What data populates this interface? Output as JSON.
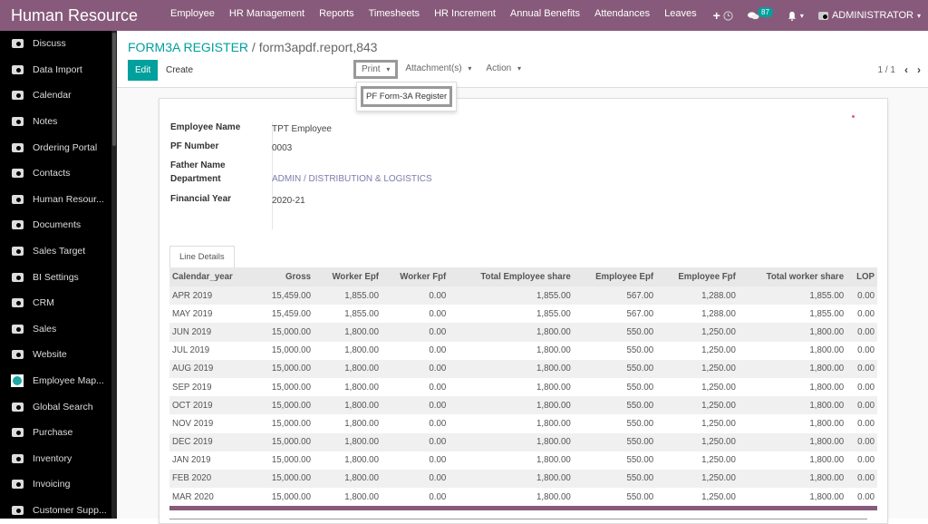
{
  "topbar": {
    "brand": "Human Resource",
    "menu": [
      "Employee",
      "HR Management",
      "Reports",
      "Timesheets",
      "HR Increment",
      "Annual Benefits",
      "Attendances",
      "Leaves"
    ],
    "plus": "+",
    "message_count": "87",
    "user": "ADMINISTRATOR",
    "caret": "▾"
  },
  "sidebar": {
    "items": [
      {
        "label": "Discuss",
        "icon": "camera-icon"
      },
      {
        "label": "Data Import",
        "icon": "camera-icon"
      },
      {
        "label": "Calendar",
        "icon": "camera-icon"
      },
      {
        "label": "Notes",
        "icon": "camera-icon"
      },
      {
        "label": "Ordering Portal",
        "icon": "camera-icon"
      },
      {
        "label": "Contacts",
        "icon": "camera-icon"
      },
      {
        "label": "Human Resour...",
        "icon": "camera-icon"
      },
      {
        "label": "Documents",
        "icon": "camera-icon"
      },
      {
        "label": "Sales Target",
        "icon": "camera-icon"
      },
      {
        "label": "BI Settings",
        "icon": "camera-icon"
      },
      {
        "label": "CRM",
        "icon": "camera-icon"
      },
      {
        "label": "Sales",
        "icon": "camera-icon"
      },
      {
        "label": "Website",
        "icon": "camera-icon"
      },
      {
        "label": "Employee Map...",
        "icon": "map-pin-icon"
      },
      {
        "label": "Global Search",
        "icon": "camera-icon"
      },
      {
        "label": "Purchase",
        "icon": "camera-icon"
      },
      {
        "label": "Inventory",
        "icon": "camera-icon"
      },
      {
        "label": "Invoicing",
        "icon": "camera-icon"
      },
      {
        "label": "Customer Supp...",
        "icon": "camera-icon"
      }
    ]
  },
  "control_panel": {
    "breadcrumb_root": "FORM3A REGISTER",
    "breadcrumb_sep": "/",
    "breadcrumb_current": "form3apdf.report,843",
    "edit_label": "Edit",
    "create_label": "Create",
    "print_label": "Print",
    "attachments_label": "Attachment(s)",
    "action_label": "Action",
    "dropdown_caret": "▾",
    "print_options": [
      "PF Form-3A Register"
    ],
    "pager": "1 / 1",
    "prev": "‹",
    "next": "›"
  },
  "form": {
    "fields": [
      {
        "label": "Employee Name",
        "value": "TPT Employee"
      },
      {
        "label": "PF Number",
        "value": "0003"
      },
      {
        "label": "Father Name",
        "value": ""
      },
      {
        "label": "Department",
        "value": "ADMIN / DISTRIBUTION & LOGISTICS"
      },
      {
        "label": "Financial Year",
        "value": "2020-21"
      }
    ],
    "tab_label": "Line Details"
  },
  "table": {
    "columns": [
      "Calendar_year",
      "Gross",
      "Worker Epf",
      "Worker Fpf",
      "Total Employee share",
      "Employee Epf",
      "Employee Fpf",
      "Total worker share",
      "LOP"
    ],
    "rows": [
      [
        "APR 2019",
        "15,459.00",
        "1,855.00",
        "0.00",
        "1,855.00",
        "567.00",
        "1,288.00",
        "1,855.00",
        "0.00"
      ],
      [
        "MAY 2019",
        "15,459.00",
        "1,855.00",
        "0.00",
        "1,855.00",
        "567.00",
        "1,288.00",
        "1,855.00",
        "0.00"
      ],
      [
        "JUN 2019",
        "15,000.00",
        "1,800.00",
        "0.00",
        "1,800.00",
        "550.00",
        "1,250.00",
        "1,800.00",
        "0.00"
      ],
      [
        "JUL 2019",
        "15,000.00",
        "1,800.00",
        "0.00",
        "1,800.00",
        "550.00",
        "1,250.00",
        "1,800.00",
        "0.00"
      ],
      [
        "AUG 2019",
        "15,000.00",
        "1,800.00",
        "0.00",
        "1,800.00",
        "550.00",
        "1,250.00",
        "1,800.00",
        "0.00"
      ],
      [
        "SEP 2019",
        "15,000.00",
        "1,800.00",
        "0.00",
        "1,800.00",
        "550.00",
        "1,250.00",
        "1,800.00",
        "0.00"
      ],
      [
        "OCT 2019",
        "15,000.00",
        "1,800.00",
        "0.00",
        "1,800.00",
        "550.00",
        "1,250.00",
        "1,800.00",
        "0.00"
      ],
      [
        "NOV 2019",
        "15,000.00",
        "1,800.00",
        "0.00",
        "1,800.00",
        "550.00",
        "1,250.00",
        "1,800.00",
        "0.00"
      ],
      [
        "DEC 2019",
        "15,000.00",
        "1,800.00",
        "0.00",
        "1,800.00",
        "550.00",
        "1,250.00",
        "1,800.00",
        "0.00"
      ],
      [
        "JAN 2019",
        "15,000.00",
        "1,800.00",
        "0.00",
        "1,800.00",
        "550.00",
        "1,250.00",
        "1,800.00",
        "0.00"
      ],
      [
        "FEB 2020",
        "15,000.00",
        "1,800.00",
        "0.00",
        "1,800.00",
        "550.00",
        "1,250.00",
        "1,800.00",
        "0.00"
      ],
      [
        "MAR 2020",
        "15,000.00",
        "1,800.00",
        "0.00",
        "1,800.00",
        "550.00",
        "1,250.00",
        "1,800.00",
        "0.00"
      ]
    ]
  },
  "colors": {
    "brand": "#875a7b",
    "accent": "#00a09d",
    "link": "#7c7bad"
  }
}
